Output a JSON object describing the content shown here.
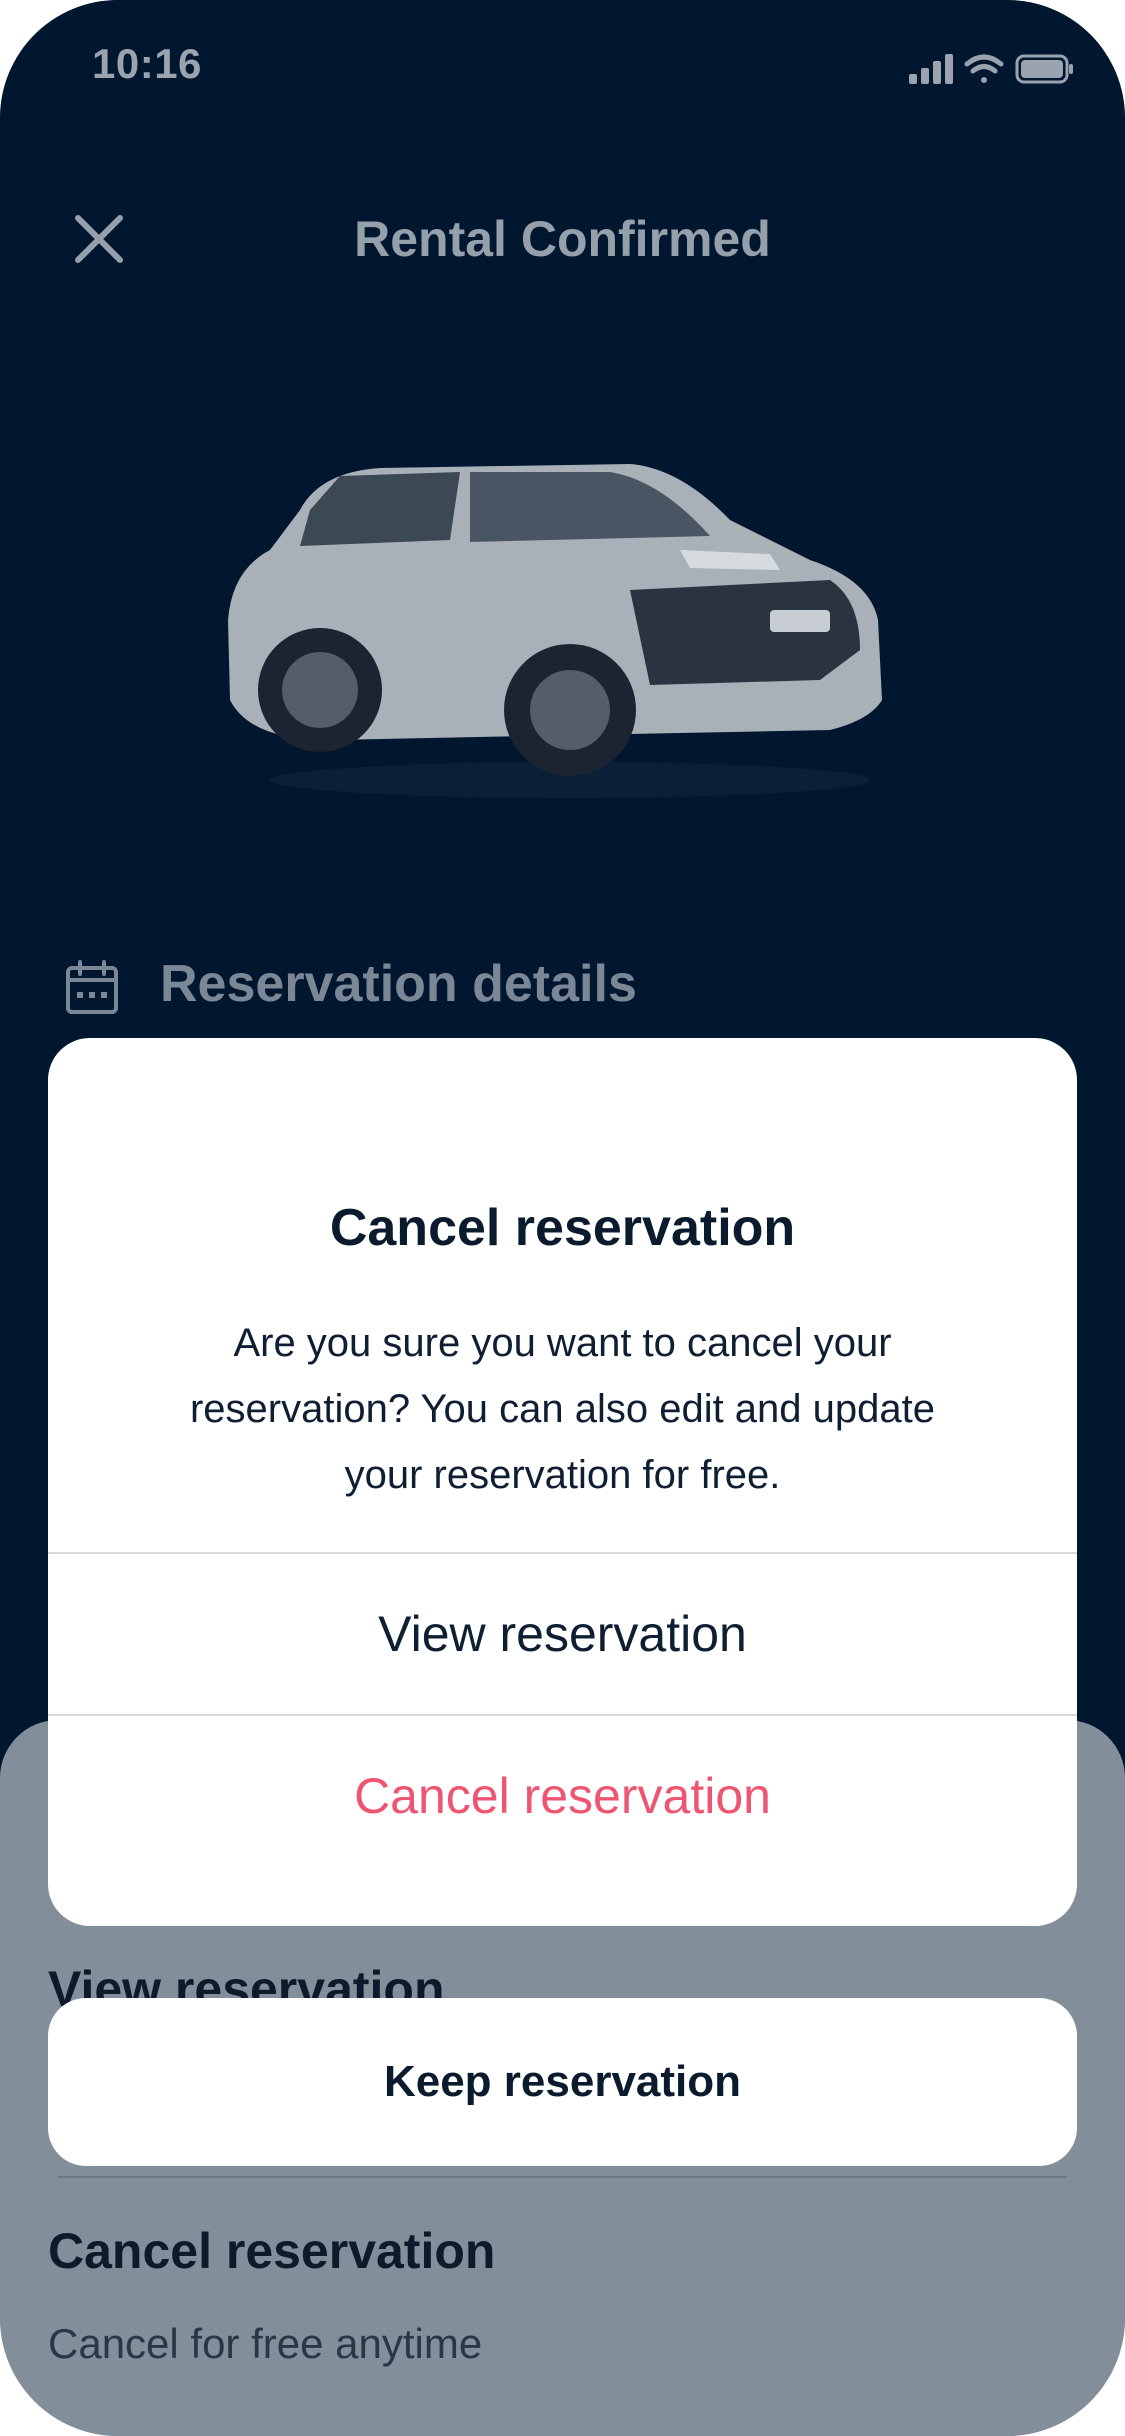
{
  "status_bar": {
    "time": "10:16",
    "signal_icon": "signal-icon",
    "wifi_icon": "wifi-icon",
    "battery_icon": "battery-icon"
  },
  "header": {
    "title": "Rental Confirmed",
    "close_icon": "close-icon"
  },
  "car": {
    "image_icon": "car-image"
  },
  "details_section": {
    "title": "Reservation details",
    "icon": "calendar-icon"
  },
  "sheet": {
    "view_label": "View reservation",
    "cancel_title": "Cancel  reservation",
    "cancel_subtitle": "Cancel for free anytime"
  },
  "alert": {
    "title": "Cancel reservation",
    "message": "Are you sure you want to cancel your reservation? You can also edit and update your reservation for free.",
    "view_button": "View reservation",
    "cancel_button": "Cancel reservation"
  },
  "keep_button": "Keep reservation",
  "colors": {
    "background": "#011730",
    "destructive": "#EE5572",
    "overlay_sheet": "#838E9B"
  }
}
